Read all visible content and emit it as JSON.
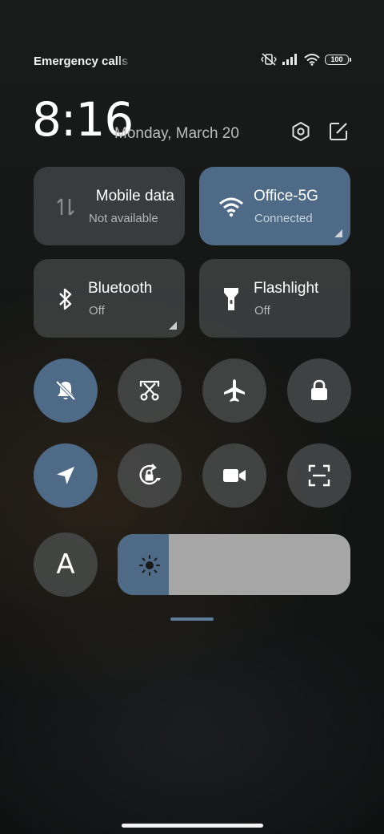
{
  "status_bar": {
    "carrier_text": "Emergency calls only",
    "battery": "100",
    "icons": [
      "vibrate-muted-icon",
      "signal-bars-icon",
      "wifi-icon",
      "battery-icon"
    ]
  },
  "header": {
    "time": "8:16",
    "date": "Monday, March 20",
    "icons": [
      "settings-icon",
      "edit-icon"
    ]
  },
  "tiles": {
    "mobile_data": {
      "title": "Mobile data",
      "subtitle": "Not available",
      "active": false,
      "icon": "data-arrows-icon"
    },
    "wifi": {
      "title": "Office-5G",
      "subtitle": "Connected",
      "active": true,
      "icon": "wifi-icon"
    },
    "bluetooth": {
      "title": "Bluetooth",
      "subtitle": "Off",
      "active": false,
      "icon": "bluetooth-icon"
    },
    "flashlight": {
      "title": "Flashlight",
      "subtitle": "Off",
      "active": false,
      "icon": "flashlight-icon"
    }
  },
  "toggles": [
    {
      "name": "silent-toggle",
      "icon": "bell-muted-icon",
      "active": true
    },
    {
      "name": "screenshot-toggle",
      "icon": "scissors-icon",
      "active": false
    },
    {
      "name": "airplane-toggle",
      "icon": "airplane-icon",
      "active": false
    },
    {
      "name": "lock-screen-toggle",
      "icon": "lock-icon",
      "active": false
    },
    {
      "name": "location-toggle",
      "icon": "location-arrow-icon",
      "active": true
    },
    {
      "name": "rotation-lock-toggle",
      "icon": "rotation-lock-icon",
      "active": false
    },
    {
      "name": "screen-recorder-toggle",
      "icon": "video-camera-icon",
      "active": false
    },
    {
      "name": "scanner-toggle",
      "icon": "scan-icon",
      "active": false
    }
  ],
  "auto_brightness": {
    "label": "A"
  },
  "brightness": {
    "level_fraction": 0.22,
    "icon": "sun-icon"
  },
  "colors": {
    "active": "#4e6a86",
    "inactive": "#4e5252",
    "slider_track": "#a6a6a6"
  }
}
